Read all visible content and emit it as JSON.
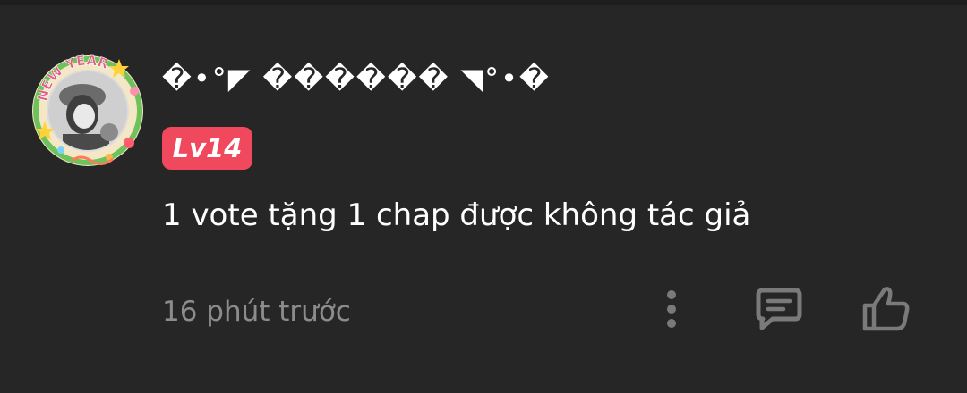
{
  "comment": {
    "username": "�•°◤ ������ ◥°•�",
    "avatar_ring_text": "NEW YEAR",
    "level": "Lv14",
    "text": "1 vote tặng 1 chap được không tác giả",
    "timestamp": "16 phút trước"
  },
  "actions": {
    "more_icon": "more-vertical-icon",
    "reply_icon": "comment-icon",
    "like_icon": "thumbs-up-icon"
  },
  "colors": {
    "background": "#262626",
    "level_badge": "#f0485c",
    "muted_text": "#8c8c8c",
    "icon": "#7a7a7a"
  }
}
